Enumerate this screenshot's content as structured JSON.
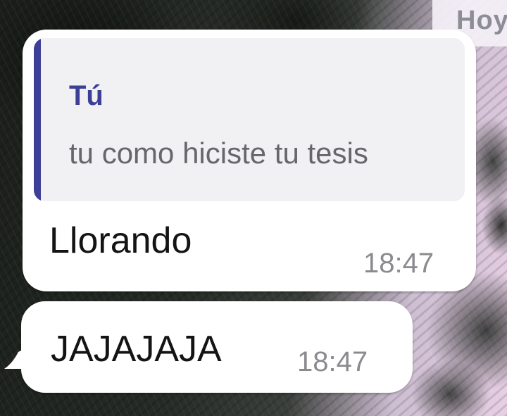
{
  "date_chip": {
    "label": "Hoy"
  },
  "messages": [
    {
      "reply_to": {
        "author": "Tú",
        "text": "tu como hiciste tu tesis",
        "accent_color": "#3d3f98"
      },
      "text": "Llorando",
      "time": "18:47"
    },
    {
      "text": "JAJAJAJA",
      "time": "18:47"
    }
  ],
  "colors": {
    "bubble_bg": "#ffffff",
    "quote_bg": "#f1f1f4",
    "timestamp": "#8b8b8f"
  }
}
